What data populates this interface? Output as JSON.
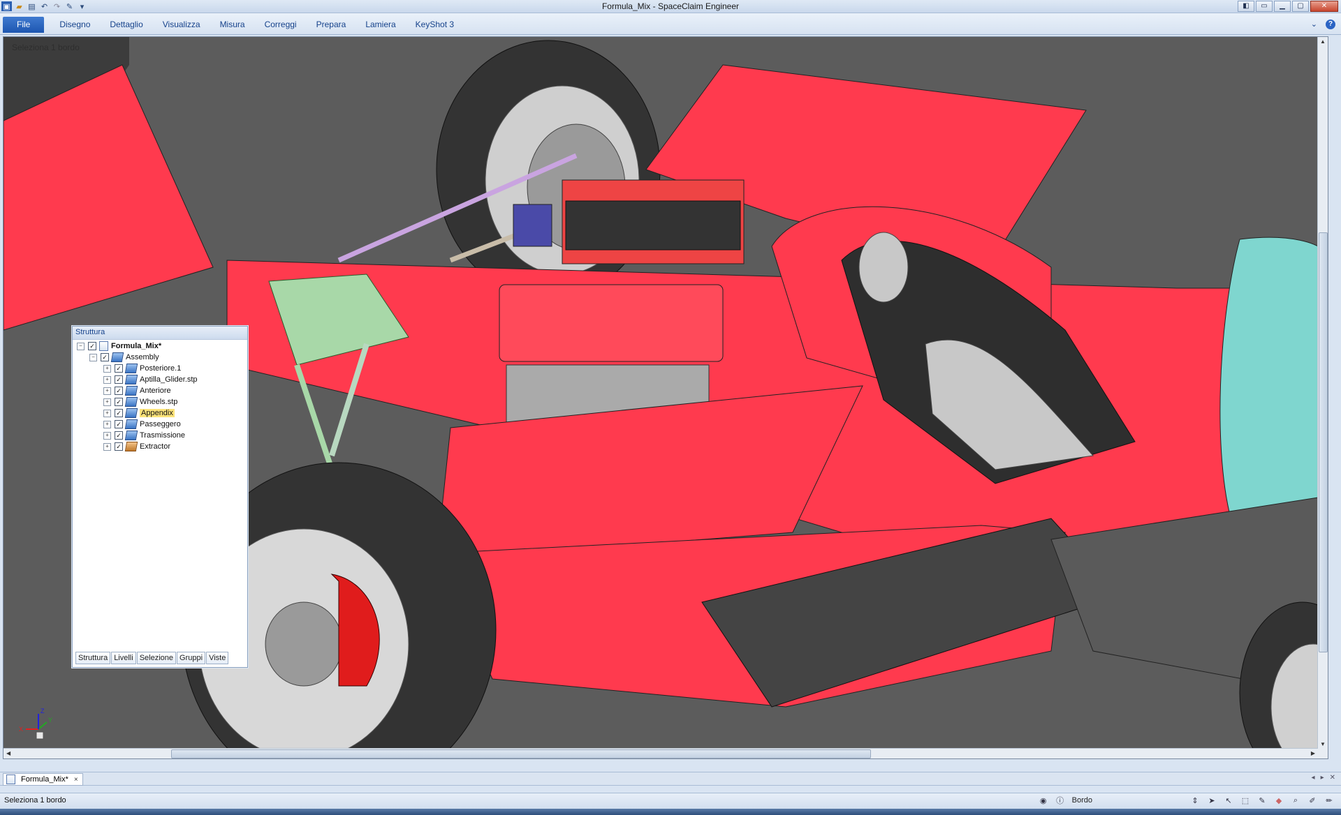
{
  "window": {
    "title": "Formula_Mix - SpaceClaim Engineer"
  },
  "qat": {
    "icons": [
      "app-menu-icon",
      "open-icon",
      "save-icon",
      "undo-icon",
      "redo-icon",
      "sketch-icon",
      "customize-icon"
    ]
  },
  "ribbon": {
    "tabs": [
      "File",
      "Disegno",
      "Dettaglio",
      "Visualizza",
      "Misura",
      "Correggi",
      "Prepara",
      "Lamiera",
      "KeyShot 3"
    ],
    "active_tab": "File",
    "help_label": "?"
  },
  "viewport": {
    "selection_hint": "Seleziona 1 bordo",
    "colors": {
      "background": "#5c5c5c",
      "body_red": "#ff3a4e",
      "glass_cyan": "#7fd6cf",
      "tire": "#3a3a3a",
      "suspension_green": "#a8d8a8",
      "rod_purple": "#c9a4e0"
    }
  },
  "structure_panel": {
    "title": "Struttura",
    "root": {
      "label": "Formula_Mix*"
    },
    "assembly": {
      "label": "Assembly"
    },
    "items": [
      {
        "label": "Posteriore.1",
        "highlighted": false
      },
      {
        "label": "Aptilla_Glider.stp",
        "highlighted": false
      },
      {
        "label": "Anteriore",
        "highlighted": false
      },
      {
        "label": "Wheels.stp",
        "highlighted": false
      },
      {
        "label": "Appendix",
        "highlighted": true
      },
      {
        "label": "Passeggero",
        "highlighted": false
      },
      {
        "label": "Trasmissione",
        "highlighted": false
      },
      {
        "label": "Extractor",
        "highlighted": false
      }
    ],
    "tabs": [
      "Struttura",
      "Livelli",
      "Selezione",
      "Gruppi",
      "Viste"
    ]
  },
  "triad": {
    "x_label": "X",
    "y_label": "Y",
    "z_label": "Z"
  },
  "document_tab": {
    "label": "Formula_Mix*",
    "close": "×"
  },
  "status": {
    "text": "Seleziona 1 bordo",
    "filter_label": "Bordo"
  }
}
